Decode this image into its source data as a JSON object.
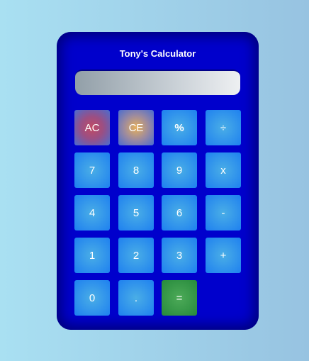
{
  "title": "Tony's Calculator",
  "display": "",
  "buttons": {
    "ac": "AC",
    "ce": "CE",
    "percent": "%",
    "divide": "÷",
    "seven": "7",
    "eight": "8",
    "nine": "9",
    "multiply": "x",
    "four": "4",
    "five": "5",
    "six": "6",
    "minus": "-",
    "one": "1",
    "two": "2",
    "three": "3",
    "plus": "+",
    "zero": "0",
    "dot": ".",
    "equals": "="
  }
}
